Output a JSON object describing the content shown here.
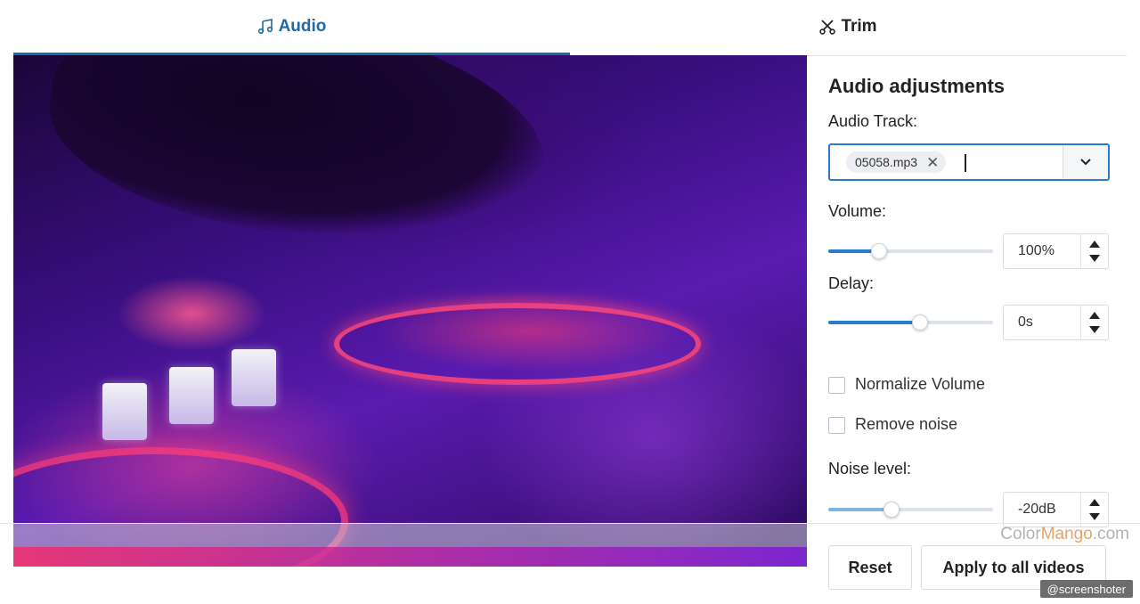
{
  "tabs": {
    "audio": "Audio",
    "trim": "Trim"
  },
  "panel": {
    "title": "Audio adjustments",
    "audio_track_label": "Audio Track:",
    "audio_track_chip": "05058.mp3",
    "volume_label": "Volume:",
    "volume_value": "100%",
    "volume_level": 0.3,
    "delay_label": "Delay:",
    "delay_value": "0s",
    "delay_level": 0.55,
    "normalize_label": "Normalize Volume",
    "normalize_checked": false,
    "remove_noise_label": "Remove noise",
    "remove_noise_checked": false,
    "noise_level_label": "Noise level:",
    "noise_level_value": "-20dB",
    "noise_level_fill": 0.38
  },
  "buttons": {
    "reset": "Reset",
    "apply_all": "Apply to all videos"
  },
  "watermarks": {
    "brand_a": "Color",
    "brand_b": "Mango",
    "brand_c": ".com",
    "screenshoter": "@screenshoter"
  },
  "colors": {
    "accent": "#1f6aa5",
    "focus_border": "#2a7bd0"
  }
}
